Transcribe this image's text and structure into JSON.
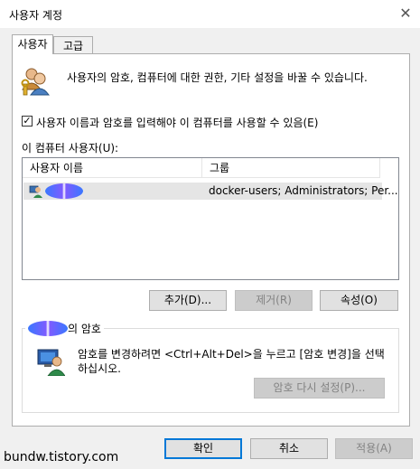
{
  "window": {
    "title": "사용자 계정"
  },
  "tabs": [
    {
      "label": "사용자"
    },
    {
      "label": "고급"
    }
  ],
  "intro_text": "사용자의 암호, 컴퓨터에 대한 권한, 기타 설정을 바꿀 수 있습니다.",
  "require_login": {
    "label": "사용자 이름과 암호를 입력해야 이 컴퓨터를 사용할 수 있음(E)",
    "checked": true
  },
  "users_label": "이 컴퓨터 사용자(U):",
  "users_table": {
    "columns": [
      "사용자 이름",
      "그룹"
    ],
    "rows": [
      {
        "name": "",
        "groups": "docker-users; Administrators; Per..."
      }
    ]
  },
  "user_buttons": {
    "add": "추가(D)...",
    "remove": "제거(R)",
    "properties": "속성(O)"
  },
  "password_group": {
    "legend_suffix": "의 암호",
    "description": "암호를 변경하려면 <Ctrl+Alt+Del>을 누르고 [암호 변경]을 선택하십시오.",
    "reset_button": "암호 다시 설정(P)..."
  },
  "footer_buttons": {
    "ok": "확인",
    "cancel": "취소",
    "apply": "적용(A)"
  },
  "watermark": "bundw.tistory.com",
  "colors": {
    "accent": "#0078d7",
    "disabled_text": "#838383"
  }
}
